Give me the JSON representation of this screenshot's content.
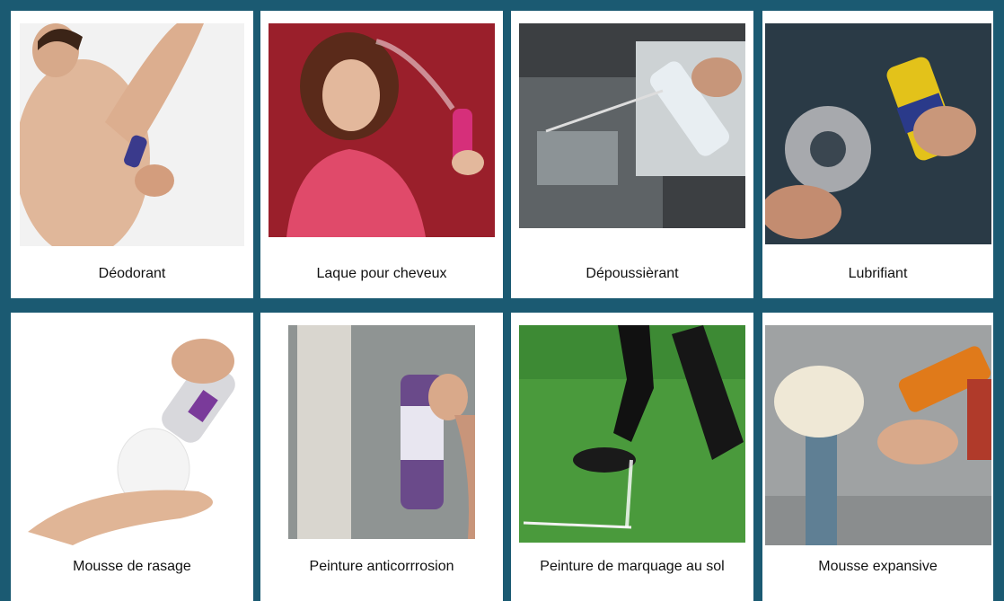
{
  "colors": {
    "border": "#1b5a72",
    "background": "#ffffff",
    "text": "#111111"
  },
  "items": [
    {
      "label": "Déodorant",
      "icon": "deodorant-photo"
    },
    {
      "label": "Laque pour cheveux",
      "icon": "hairspray-photo"
    },
    {
      "label": "Dépoussièrant",
      "icon": "air-duster-photo"
    },
    {
      "label": "Lubrifiant",
      "icon": "lubricant-photo"
    },
    {
      "label": "Mousse de rasage",
      "icon": "shaving-foam-photo"
    },
    {
      "label": "Peinture anticorrrosion",
      "icon": "anticorrosion-paint-photo"
    },
    {
      "label": "Peinture de marquage au sol",
      "icon": "field-marking-paint-photo"
    },
    {
      "label": "Mousse expansive",
      "icon": "expanding-foam-photo"
    }
  ]
}
